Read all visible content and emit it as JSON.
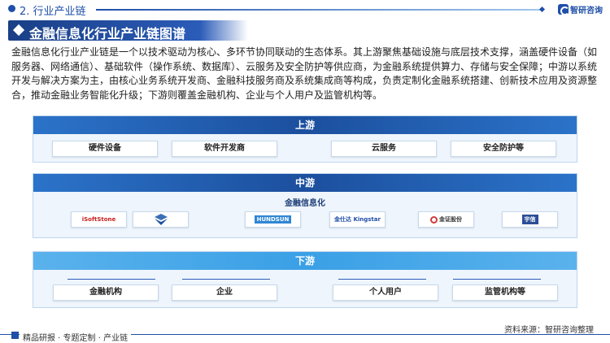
{
  "header": {
    "section_title": "2. 行业产业链",
    "logo_text": "智研咨询"
  },
  "banner": {
    "title": "金融信息化行业产业链图谱"
  },
  "intro": "金融信息化行业产业链是一个以技术驱动为核心、多环节协同联动的生态体系。其上游聚焦基础设施与底层技术支撑，涵盖硬件设备（如服务器、网络通信）、基础软件（操作系统、数据库）、云服务及安全防护等供应商，为金融系统提供算力、存储与安全保障；中游以系统开发与解决方案为主，由核心业务系统开发商、金融科技服务商及系统集成商等构成，负责定制化金融系统搭建、创新技术应用及资源整合，推动金融业务智能化升级；下游则覆盖金融机构、企业与个人用户及监管机构等。",
  "upstream": {
    "label": "上游",
    "items": [
      "硬件设备",
      "软件开发商",
      "云服务",
      "安全防护等"
    ]
  },
  "midstream": {
    "label": "中游",
    "sub_label": "金融信息化",
    "companies": [
      {
        "name": "iSoftStone",
        "icon": "isoftstone-logo"
      },
      {
        "name": "",
        "icon": "s-shield-logo"
      },
      {
        "name": "HUNDSUN",
        "icon": "hundsun-logo"
      },
      {
        "name": "金仕达 Kingstar",
        "icon": "kingstar-logo"
      },
      {
        "name": "金证股份",
        "icon": "kingdom-logo"
      },
      {
        "name": "宇信",
        "icon": "yusys-logo"
      }
    ]
  },
  "downstream": {
    "label": "下游",
    "items": [
      "金融机构",
      "企业",
      "个人用户",
      "监管机构等"
    ]
  },
  "footer": {
    "left": "精品研报 · 专题定制 · 产业链",
    "source": "资料来源：智研咨询整理"
  },
  "colors": {
    "primary": "#1f4fa8",
    "header_dark": "#1c4f9e",
    "header_light": "#3aa0e6",
    "panel_bg": "#eef5fd"
  }
}
